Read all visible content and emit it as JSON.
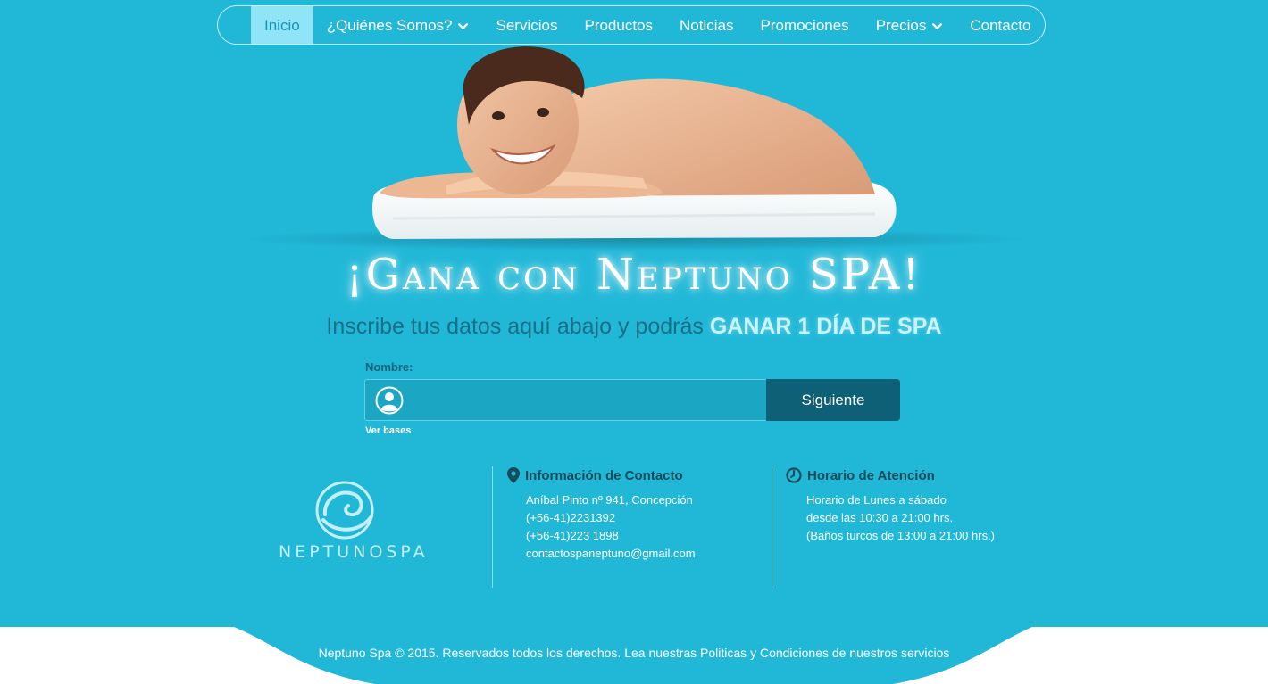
{
  "nav": {
    "items": [
      {
        "label": "Inicio",
        "active": true,
        "dropdown": false
      },
      {
        "label": "¿Quiénes Somos?",
        "active": false,
        "dropdown": true
      },
      {
        "label": "Servicios",
        "active": false,
        "dropdown": false
      },
      {
        "label": "Productos",
        "active": false,
        "dropdown": false
      },
      {
        "label": "Noticias",
        "active": false,
        "dropdown": false
      },
      {
        "label": "Promociones",
        "active": false,
        "dropdown": false
      },
      {
        "label": "Precios",
        "active": false,
        "dropdown": true
      },
      {
        "label": "Contacto",
        "active": false,
        "dropdown": false
      }
    ]
  },
  "hero": {
    "headline": "¡Gana con Neptuno SPA!",
    "subline_text": "Inscribe tus datos aquí abajo y podrás ",
    "subline_highlight": "GANAR 1 DÍA DE SPA"
  },
  "form": {
    "name_label": "Nombre:",
    "name_value": "",
    "submit_label": "Siguiente",
    "bases_link": "Ver bases"
  },
  "brand": {
    "logo_text": "NEPTUNOSPA"
  },
  "contact": {
    "title": "Información de Contacto",
    "lines": [
      "Aníbal Pinto nº 941, Concepción",
      "(+56-41)2231392",
      "(+56-41)223 1898",
      "contactospaneptuno@gmail.com"
    ]
  },
  "hours": {
    "title": "Horario de Atención",
    "lines": [
      "Horario de Lunes a sábado",
      "desde las 10:30 a 21:00 hrs.",
      "(Baños turcos de 13:00 a 21:00 hrs.)"
    ]
  },
  "footer": {
    "text": "Neptuno Spa © 2015. Reservados todos los derechos. Lea nuestras Politicas y Condiciones de nuestros servicios"
  },
  "colors": {
    "background": "#21b8d8",
    "nav_active_bg": "#8fe4f8",
    "button_bg": "#0d6076",
    "highlight": "#c8f3ff",
    "footer_bg": "#ffffff"
  },
  "icons": {
    "nav_dropdown": "chevron-down-icon",
    "field": "user-icon",
    "contact": "map-pin-icon",
    "hours": "clock-icon"
  }
}
